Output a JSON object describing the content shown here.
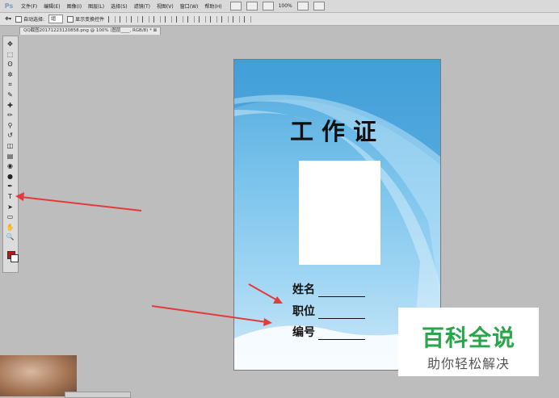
{
  "app": {
    "logo": "Ps"
  },
  "menu": {
    "items": [
      "文件(F)",
      "编辑(E)",
      "图像(I)",
      "图层(L)",
      "选择(S)",
      "滤镜(T)",
      "视图(V)",
      "窗口(W)",
      "帮助(H)"
    ],
    "zoom": "100%"
  },
  "options": {
    "auto_select_label": "自动选择:",
    "auto_select_value": "组",
    "show_transform_label": "显示变换控件"
  },
  "document": {
    "tab_title": "QQ截图20171223120858.png @ 100% (图层____, RGB/8) * ⊠"
  },
  "tools": {
    "icons": [
      "move-icon",
      "marquee-icon",
      "lasso-icon",
      "magic-wand-icon",
      "crop-icon",
      "eyedropper-icon",
      "healing-brush-icon",
      "brush-icon",
      "clone-stamp-icon",
      "history-brush-icon",
      "eraser-icon",
      "gradient-icon",
      "blur-icon",
      "dodge-icon",
      "pen-icon",
      "type-icon",
      "path-select-icon",
      "shape-icon",
      "hand-icon",
      "zoom-icon"
    ],
    "glyphs": [
      "✥",
      "⬚",
      "ʘ",
      "✲",
      "⌗",
      "✎",
      "✚",
      "✏",
      "⚲",
      "↺",
      "◫",
      "▤",
      "◉",
      "●",
      "✒",
      "T",
      "➤",
      "▭",
      "✋",
      "🔍"
    ]
  },
  "card": {
    "title": "工作证",
    "fields": [
      {
        "label": "姓名"
      },
      {
        "label": "职位"
      },
      {
        "label": "编号"
      }
    ]
  },
  "watermark": {
    "main": "百科全说",
    "sub": "助你轻松解决"
  },
  "colors": {
    "foreground": "#c41515",
    "background": "#ffffff",
    "arrow": "#e23b3b"
  }
}
